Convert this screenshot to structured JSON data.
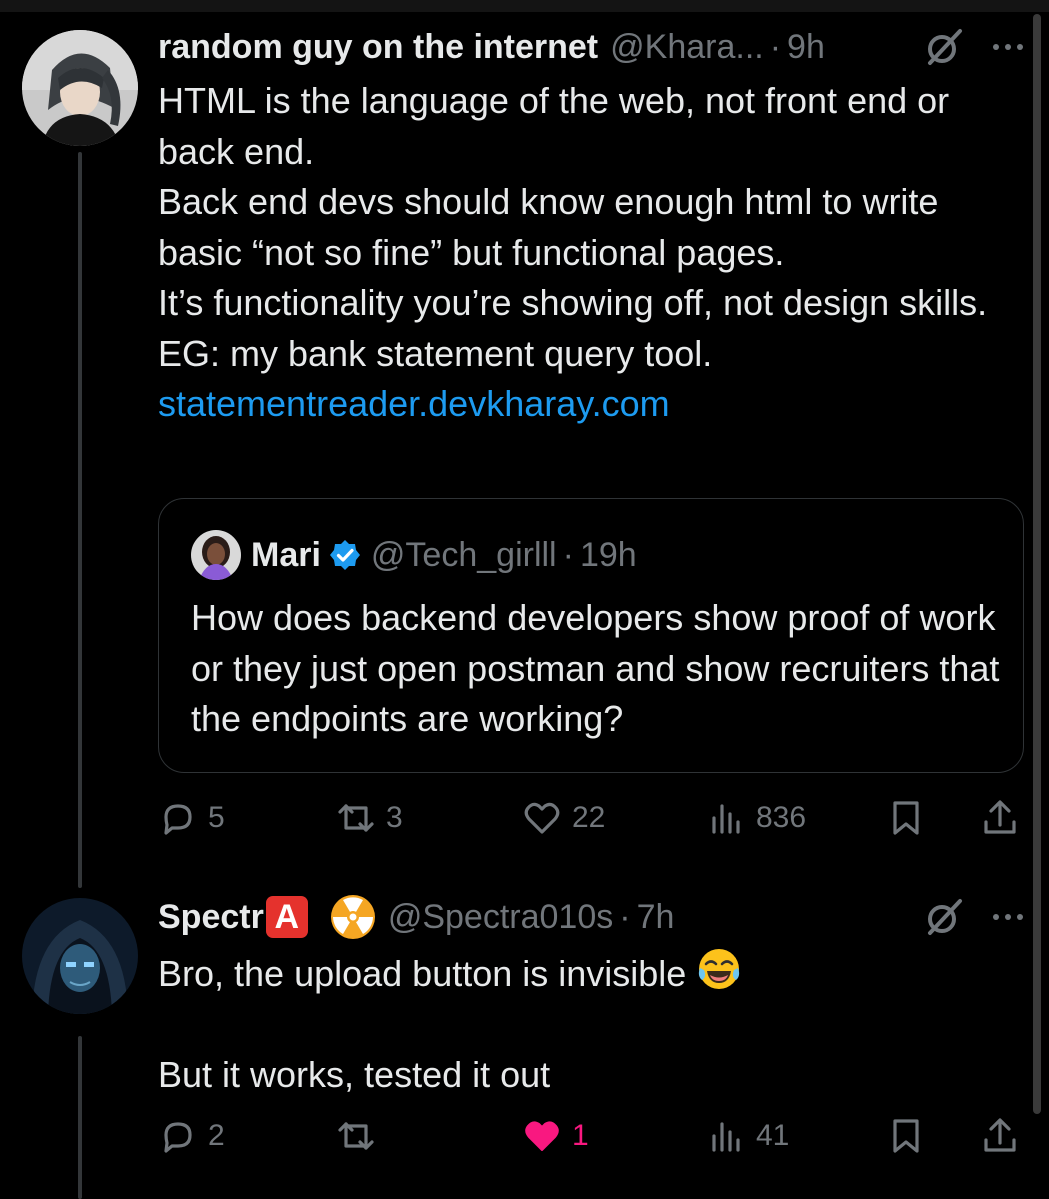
{
  "post1": {
    "author_name": "random guy on the internet",
    "handle": "@Khara...",
    "separator": "·",
    "time": "9h",
    "text_lines": [
      "HTML is the language of the web, not front end or back end.",
      "Back end devs should know enough html to write basic “not so fine” but functional pages.",
      "It’s functionality you’re showing off, not design skills.",
      "EG: my bank statement query tool."
    ],
    "link": "statementreader.devkharay.com",
    "quote": {
      "author_name": "Mari",
      "handle": "@Tech_girlll",
      "separator": "·",
      "time": "19h",
      "text": "How does backend developers show proof of work or they just open postman and show recruiters that the endpoints are working?"
    },
    "actions": {
      "replies": "5",
      "reposts": "3",
      "likes": "22",
      "views": "836"
    }
  },
  "post2": {
    "author_name": "Spectr",
    "name_badge": "A",
    "handle": "@Spectra010s",
    "separator": "·",
    "time": "7h",
    "text_line1": "Bro, the upload button is invisible",
    "text_line2": "But it works, tested it out",
    "actions": {
      "replies": "2",
      "reposts": "",
      "likes": "1",
      "views": "41"
    }
  },
  "icons": {
    "reply": "reply-bubble-icon",
    "repost": "repost-arrows-icon",
    "like": "heart-icon",
    "views": "bar-chart-icon",
    "bookmark": "bookmark-icon",
    "share": "share-upload-icon",
    "grok": "grok-slash-circle-icon",
    "more": "more-dots-icon"
  },
  "colors": {
    "background": "#000000",
    "text": "#e7e9ea",
    "muted": "#71767b",
    "link": "#1d9bf0",
    "like_active": "#f91880"
  }
}
